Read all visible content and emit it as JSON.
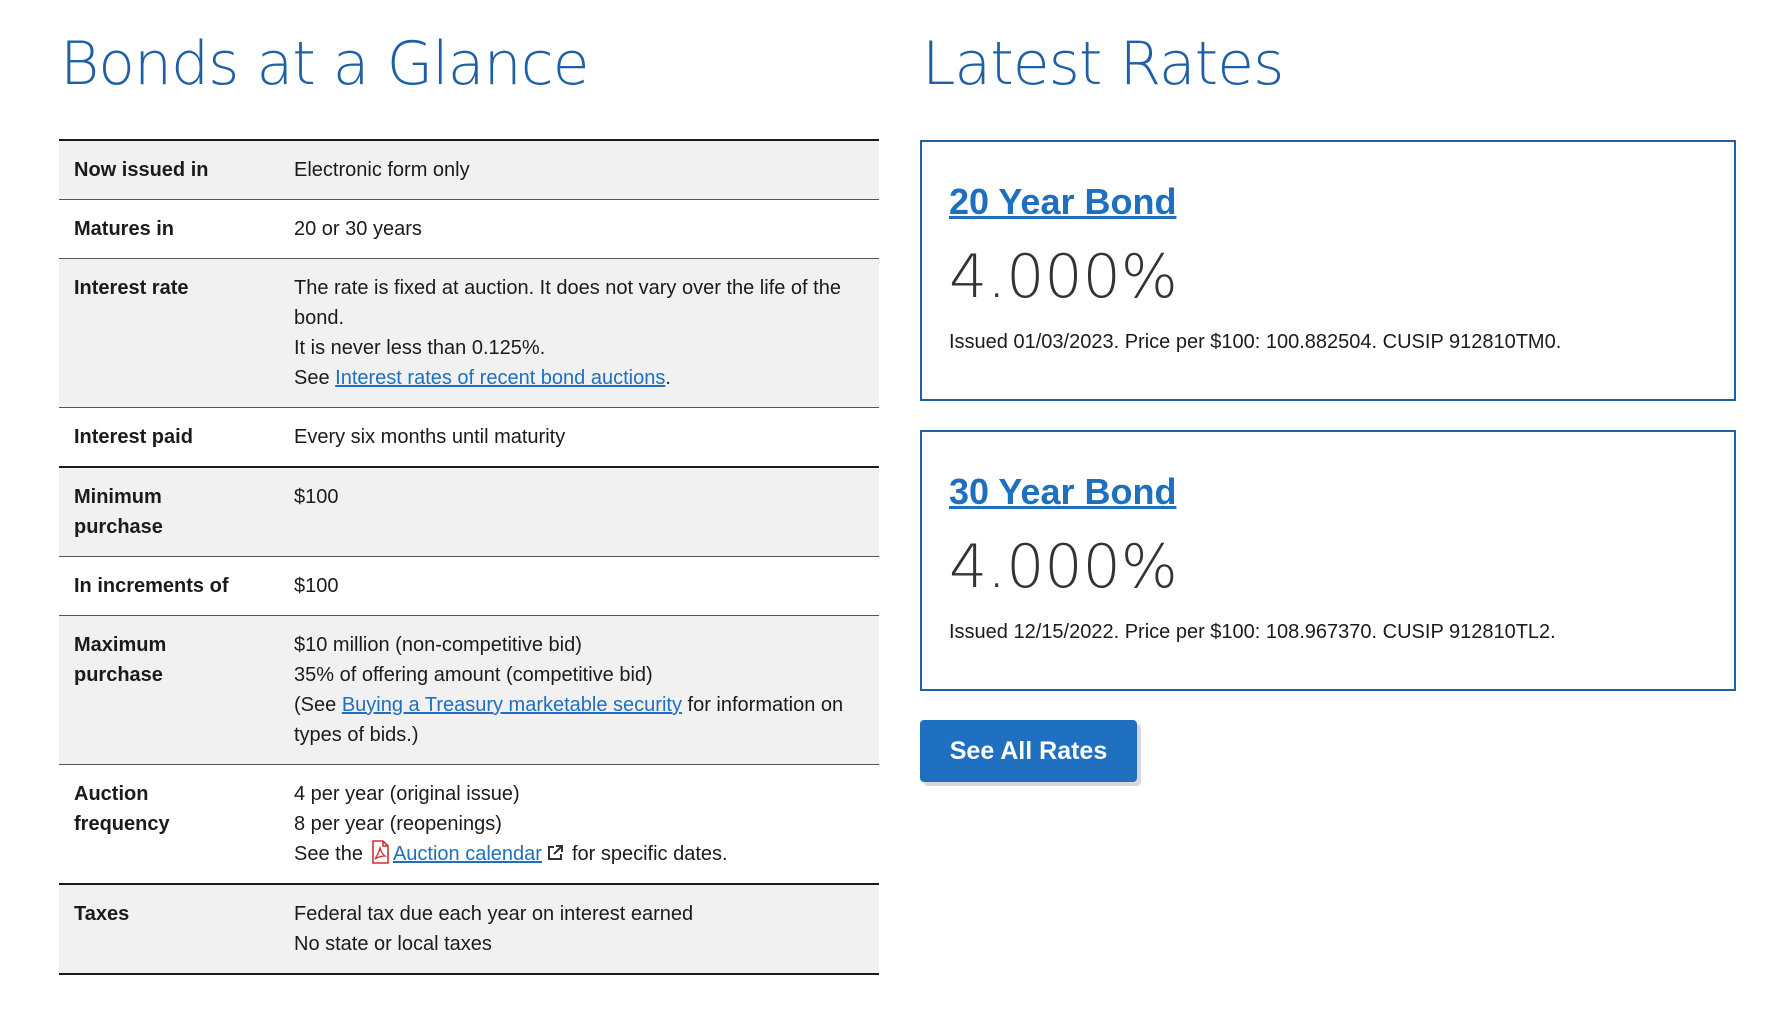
{
  "left": {
    "title": "Bonds at a Glance",
    "rows": [
      {
        "label": "Now issued in",
        "lines": [
          "Electronic form only"
        ]
      },
      {
        "label": "Matures in",
        "lines": [
          "20 or 30 years"
        ]
      },
      {
        "label": "Interest rate",
        "lines": [
          "The rate is fixed at auction. It does not vary over the life of the bond.",
          "It is never less than 0.125%."
        ],
        "see_prefix": "See ",
        "see_link": "Interest rates of recent bond auctions",
        "see_suffix": "."
      },
      {
        "label": "Interest paid",
        "lines": [
          "Every six months until maturity"
        ]
      },
      {
        "label": "Minimum purchase",
        "lines": [
          "$100"
        ]
      },
      {
        "label": "In increments of",
        "lines": [
          "$100"
        ]
      },
      {
        "label": "Maximum purchase",
        "lines": [
          "$10 million (non-competitive bid)",
          "35% of offering amount (competitive bid)"
        ],
        "see_prefix": "(See ",
        "see_link": "Buying a Treasury marketable security",
        "see_suffix": " for information on types of bids.)"
      },
      {
        "label": "Auction frequency",
        "lines": [
          "4 per year (original issue)",
          "8 per year (reopenings)"
        ],
        "see_prefix": "See the",
        "see_link": "Auction calendar",
        "see_suffix": "for specific dates.",
        "icons": [
          "pdf-icon",
          "external-link-icon"
        ]
      },
      {
        "label": "Taxes",
        "lines": [
          "Federal tax due each year on interest earned",
          "No state or local taxes"
        ]
      }
    ]
  },
  "right": {
    "title": "Latest Rates",
    "cards": [
      {
        "name": "20 Year Bond",
        "rate": "4.000%",
        "desc": "Issued 01/03/2023. Price per $100: 100.882504. CUSIP 912810TM0."
      },
      {
        "name": "30 Year Bond",
        "rate": "4.000%",
        "desc": "Issued 12/15/2022. Price per $100: 108.967370. CUSIP 912810TL2."
      }
    ],
    "button": "See All Rates"
  },
  "colors": {
    "heading": "#1e5fa6",
    "link": "#1f6fc0",
    "button": "#1f70c1",
    "shaded_row": "#f1f1f1"
  }
}
